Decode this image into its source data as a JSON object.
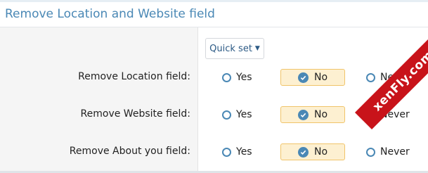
{
  "section": {
    "title": "Remove Location and Website field"
  },
  "quick_set": {
    "label": "Quick set"
  },
  "options": {
    "yes": "Yes",
    "no": "No",
    "never": "Never"
  },
  "rows": [
    {
      "label": "Remove Location field:",
      "selected": "No"
    },
    {
      "label": "Remove Website field:",
      "selected": "No"
    },
    {
      "label": "Remove About you field:",
      "selected": "No"
    }
  ],
  "watermark": {
    "text": "xenFly.com"
  },
  "colors": {
    "accent": "#4a88b5",
    "selected_bg": "#fdf0d1",
    "selected_border": "#f0c46a",
    "watermark_bg": "#c8131a"
  }
}
